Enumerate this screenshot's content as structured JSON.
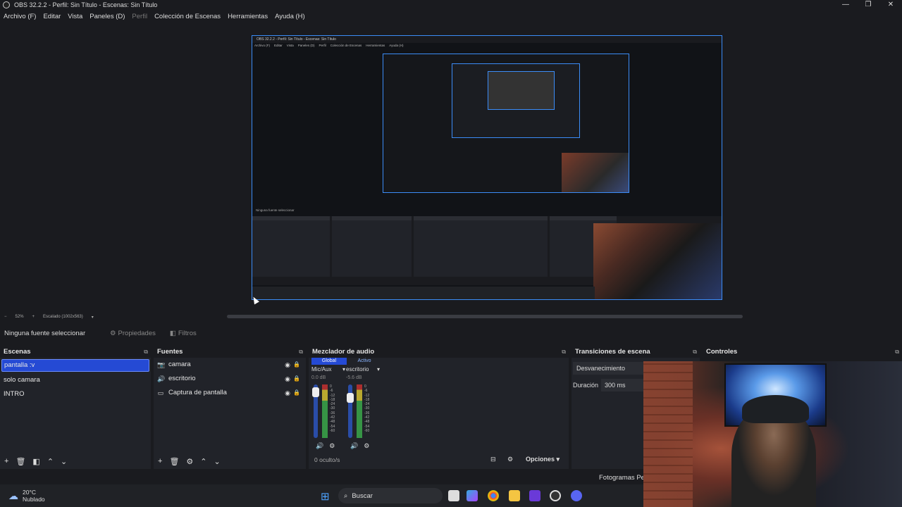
{
  "window": {
    "title": "OBS 32.2.2 - Perfil: Sin Título - Escenas: Sin Título",
    "controls": [
      "—",
      "❐",
      "✕"
    ]
  },
  "menu": {
    "items": [
      "Archivo (F)",
      "Editar",
      "Vista",
      "Paneles (D)",
      "Perfil",
      "Colección de Escenas",
      "Herramientas",
      "Ayuda (H)"
    ]
  },
  "zoom": {
    "minus": "−",
    "level": "52%",
    "plus": "+",
    "scaled": "Escalado (1002x563)"
  },
  "context": {
    "no_selection": "Ninguna fuente seleccionar",
    "properties": "Propiedades",
    "filters": "Filtros"
  },
  "scenes": {
    "title": "Escenas",
    "items": [
      "pantalla :v",
      "solo camara",
      "INTRO"
    ]
  },
  "sources": {
    "title": "Fuentes",
    "items": [
      {
        "icon": "camera-icon",
        "label": "camara"
      },
      {
        "icon": "speaker-icon",
        "label": "escritorio"
      },
      {
        "icon": "monitor-icon",
        "label": "Captura de pantalla"
      }
    ]
  },
  "mixer": {
    "title": "Mezclador de audio",
    "tabs": [
      "Global",
      "Activo"
    ],
    "channels": [
      {
        "name": "Mic/Aux",
        "db": "0.0 dB"
      },
      {
        "name": "escritorio",
        "db": "-5.6 dB"
      }
    ],
    "scale": [
      "0",
      "-6",
      "-12",
      "-18",
      "-24",
      "-30",
      "-36",
      "-42",
      "-48",
      "-54",
      "-60"
    ],
    "hidden": "0 oculto/s",
    "options": "Opciones"
  },
  "transitions": {
    "title": "Transiciones de escena",
    "selected": "Desvanecimiento",
    "duration_label": "Duración",
    "duration_value": "300 ms"
  },
  "controls": {
    "title": "Controles"
  },
  "status": {
    "fps_text": "Fotogramas Per"
  },
  "taskbar": {
    "temp": "20°C",
    "weather": "Nublado",
    "search": "Buscar"
  },
  "nested_preview": {
    "title": "OBS 32.2.2 - Perfil: Sin Título - Escenas: Sin Título",
    "menu": [
      "Archivo (F)",
      "Editar",
      "Vista",
      "Paneles (D)",
      "Perfil",
      "Colección de Escenas",
      "Herramientas",
      "Ayuda (H)"
    ],
    "status": "Ninguna fuente seleccionar"
  },
  "colors": {
    "accent": "#254ad4",
    "border_blue": "#3b8cf7",
    "background": "#1a1b1f",
    "panel": "#212329"
  }
}
